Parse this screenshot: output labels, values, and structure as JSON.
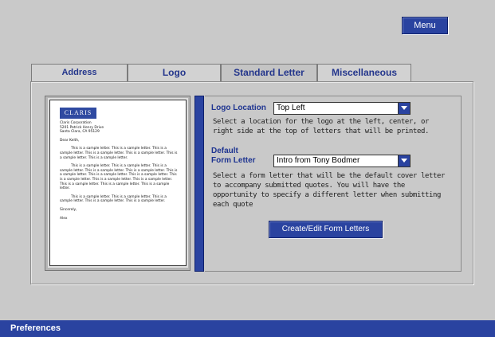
{
  "menu_button": "Menu",
  "tabs": [
    {
      "label": "Address"
    },
    {
      "label": "Logo"
    },
    {
      "label": "Standard Letter"
    },
    {
      "label": "Miscellaneous"
    }
  ],
  "letter_preview": {
    "logo_text": "CLARIS",
    "address_lines": [
      "Claris Corporation",
      "5201 Patrick Henry Drive",
      "Santa Clara, CA 95129"
    ],
    "salutation": "Dear Keith,",
    "paragraphs": [
      "This is a sample letter. This is a sample letter. This is a sample letter. This is a sample letter. This is a sample letter. This is a sample letter. This is a sample letter.",
      "This is a sample letter. This is a sample letter. This is a sample letter. This is a sample letter. This is a sample letter. This is a sample letter. This is a sample letter. This is a sample letter. This is a sample letter. This is a sample letter. This is a sample letter. This is a sample letter. This is a sample letter. This is a sample letter.",
      "This is a sample letter. This is a sample letter. This is a sample letter. This is a sample letter. This is a sample letter."
    ],
    "closing": "Sincerely,",
    "signature": "Alex"
  },
  "logo_location": {
    "label": "Logo Location",
    "value": "Top Left",
    "help": "Select a location for the logo at the left, center, or right side at the top of letters that will be printed."
  },
  "default_form_letter": {
    "label_line1": "Default",
    "label_line2": "Form Letter",
    "value": "Intro from Tony Bodmer",
    "help": "Select a form letter that will be the default cover letter to accompany submitted quotes. You will have the opportunity to specify a different letter when submitting each quote"
  },
  "create_button": "Create/Edit Form Letters",
  "footer_title": "Preferences"
}
